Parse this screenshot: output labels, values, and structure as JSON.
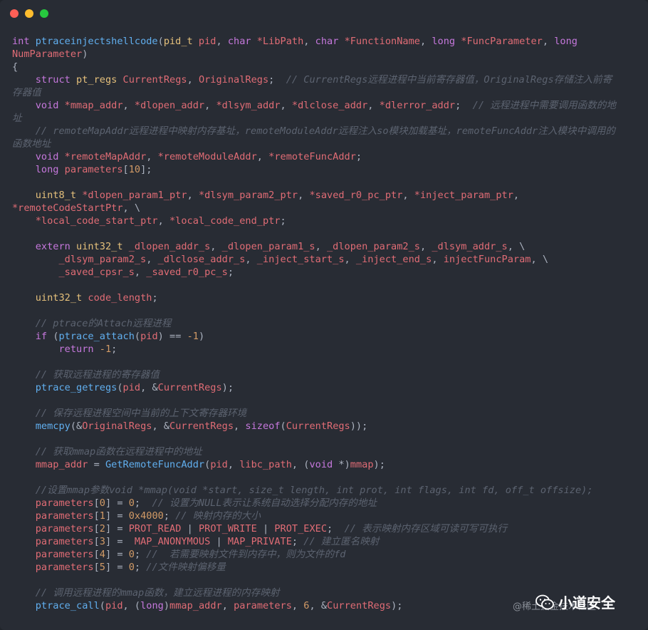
{
  "window": {
    "controls": [
      "close",
      "minimize",
      "maximize"
    ]
  },
  "code": {
    "language": "c",
    "lines": [
      [
        [
          "k",
          "int "
        ],
        [
          "f",
          "ptraceinjectshellcode"
        ],
        [
          "p",
          "("
        ],
        [
          "t",
          "pid_t "
        ],
        [
          "v",
          "pid"
        ],
        [
          "p",
          ", "
        ],
        [
          "k",
          "char "
        ],
        [
          "v",
          "*LibPath"
        ],
        [
          "p",
          ", "
        ],
        [
          "k",
          "char "
        ],
        [
          "v",
          "*FunctionName"
        ],
        [
          "p",
          ", "
        ],
        [
          "k",
          "long "
        ],
        [
          "v",
          "*FuncParameter"
        ],
        [
          "p",
          ", "
        ],
        [
          "k",
          "long"
        ]
      ],
      [
        [
          "v",
          "NumParameter"
        ],
        [
          "p",
          ")"
        ]
      ],
      [
        [
          "p",
          "{"
        ]
      ],
      [
        [
          "p",
          "    "
        ],
        [
          "k",
          "struct "
        ],
        [
          "t",
          "pt_regs "
        ],
        [
          "v",
          "CurrentRegs"
        ],
        [
          "p",
          ", "
        ],
        [
          "v",
          "OriginalRegs"
        ],
        [
          "p",
          ";  "
        ],
        [
          "c",
          "// CurrentRegs远程进程中当前寄存器值，OriginalRegs存储注入前寄"
        ]
      ],
      [
        [
          "c",
          "存器值"
        ]
      ],
      [
        [
          "p",
          "    "
        ],
        [
          "k",
          "void "
        ],
        [
          "v",
          "*mmap_addr"
        ],
        [
          "p",
          ", "
        ],
        [
          "v",
          "*dlopen_addr"
        ],
        [
          "p",
          ", "
        ],
        [
          "v",
          "*dlsym_addr"
        ],
        [
          "p",
          ", "
        ],
        [
          "v",
          "*dlclose_addr"
        ],
        [
          "p",
          ", "
        ],
        [
          "v",
          "*dlerror_addr"
        ],
        [
          "p",
          ";  "
        ],
        [
          "c",
          "// 远程进程中需要调用函数的地"
        ]
      ],
      [
        [
          "c",
          "址"
        ]
      ],
      [
        [
          "p",
          "    "
        ],
        [
          "c",
          "// remoteMapAddr远程进程中映射内存基址，remoteModuleAddr远程注入so模块加载基址，remoteFuncAddr注入模块中调用的"
        ]
      ],
      [
        [
          "c",
          "函数地址"
        ]
      ],
      [
        [
          "p",
          "    "
        ],
        [
          "k",
          "void "
        ],
        [
          "v",
          "*remoteMapAddr"
        ],
        [
          "p",
          ", "
        ],
        [
          "v",
          "*remoteModuleAddr"
        ],
        [
          "p",
          ", "
        ],
        [
          "v",
          "*remoteFuncAddr"
        ],
        [
          "p",
          ";"
        ]
      ],
      [
        [
          "p",
          "    "
        ],
        [
          "k",
          "long "
        ],
        [
          "v",
          "parameters"
        ],
        [
          "p",
          "["
        ],
        [
          "n",
          "10"
        ],
        [
          "p",
          "];"
        ]
      ],
      [],
      [
        [
          "p",
          "    "
        ],
        [
          "t",
          "uint8_t "
        ],
        [
          "v",
          "*dlopen_param1_ptr"
        ],
        [
          "p",
          ", "
        ],
        [
          "v",
          "*dlsym_param2_ptr"
        ],
        [
          "p",
          ", "
        ],
        [
          "v",
          "*saved_r0_pc_ptr"
        ],
        [
          "p",
          ", "
        ],
        [
          "v",
          "*inject_param_ptr"
        ],
        [
          "p",
          ","
        ]
      ],
      [
        [
          "v",
          "*remoteCodeStartPtr"
        ],
        [
          "p",
          ", \\"
        ]
      ],
      [
        [
          "p",
          "    "
        ],
        [
          "v",
          "*local_code_start_ptr"
        ],
        [
          "p",
          ", "
        ],
        [
          "v",
          "*local_code_end_ptr"
        ],
        [
          "p",
          ";"
        ]
      ],
      [],
      [
        [
          "p",
          "    "
        ],
        [
          "k",
          "extern "
        ],
        [
          "t",
          "uint32_t "
        ],
        [
          "v",
          "_dlopen_addr_s"
        ],
        [
          "p",
          ", "
        ],
        [
          "v",
          "_dlopen_param1_s"
        ],
        [
          "p",
          ", "
        ],
        [
          "v",
          "_dlopen_param2_s"
        ],
        [
          "p",
          ", "
        ],
        [
          "v",
          "_dlsym_addr_s"
        ],
        [
          "p",
          ", \\"
        ]
      ],
      [
        [
          "p",
          "        "
        ],
        [
          "v",
          "_dlsym_param2_s"
        ],
        [
          "p",
          ", "
        ],
        [
          "v",
          "_dlclose_addr_s"
        ],
        [
          "p",
          ", "
        ],
        [
          "v",
          "_inject_start_s"
        ],
        [
          "p",
          ", "
        ],
        [
          "v",
          "_inject_end_s"
        ],
        [
          "p",
          ", "
        ],
        [
          "v",
          "injectFuncParam"
        ],
        [
          "p",
          ", \\"
        ]
      ],
      [
        [
          "p",
          "        "
        ],
        [
          "v",
          "_saved_cpsr_s"
        ],
        [
          "p",
          ", "
        ],
        [
          "v",
          "_saved_r0_pc_s"
        ],
        [
          "p",
          ";"
        ]
      ],
      [],
      [
        [
          "p",
          "    "
        ],
        [
          "t",
          "uint32_t "
        ],
        [
          "v",
          "code_length"
        ],
        [
          "p",
          ";"
        ]
      ],
      [],
      [
        [
          "p",
          "    "
        ],
        [
          "c",
          "// ptrace的Attach远程进程"
        ]
      ],
      [
        [
          "p",
          "    "
        ],
        [
          "k",
          "if "
        ],
        [
          "p",
          "("
        ],
        [
          "f",
          "ptrace_attach"
        ],
        [
          "p",
          "("
        ],
        [
          "v",
          "pid"
        ],
        [
          "p",
          ") == "
        ],
        [
          "n",
          "-1"
        ],
        [
          "p",
          ")"
        ]
      ],
      [
        [
          "p",
          "        "
        ],
        [
          "k",
          "return "
        ],
        [
          "n",
          "-1"
        ],
        [
          "p",
          ";"
        ]
      ],
      [],
      [
        [
          "p",
          "    "
        ],
        [
          "c",
          "// 获取远程进程的寄存器值"
        ]
      ],
      [
        [
          "p",
          "    "
        ],
        [
          "f",
          "ptrace_getregs"
        ],
        [
          "p",
          "("
        ],
        [
          "v",
          "pid"
        ],
        [
          "p",
          ", &"
        ],
        [
          "v",
          "CurrentRegs"
        ],
        [
          "p",
          ");"
        ]
      ],
      [],
      [
        [
          "p",
          "    "
        ],
        [
          "c",
          "// 保存远程进程空间中当前的上下文寄存器环境"
        ]
      ],
      [
        [
          "p",
          "    "
        ],
        [
          "f",
          "memcpy"
        ],
        [
          "p",
          "(&"
        ],
        [
          "v",
          "OriginalRegs"
        ],
        [
          "p",
          ", &"
        ],
        [
          "v",
          "CurrentRegs"
        ],
        [
          "p",
          ", "
        ],
        [
          "k",
          "sizeof"
        ],
        [
          "p",
          "("
        ],
        [
          "v",
          "CurrentRegs"
        ],
        [
          "p",
          "));"
        ]
      ],
      [],
      [
        [
          "p",
          "    "
        ],
        [
          "c",
          "// 获取mmap函数在远程进程中的地址"
        ]
      ],
      [
        [
          "p",
          "    "
        ],
        [
          "v",
          "mmap_addr"
        ],
        [
          "p",
          " = "
        ],
        [
          "f",
          "GetRemoteFuncAddr"
        ],
        [
          "p",
          "("
        ],
        [
          "v",
          "pid"
        ],
        [
          "p",
          ", "
        ],
        [
          "v",
          "libc_path"
        ],
        [
          "p",
          ", ("
        ],
        [
          "k",
          "void "
        ],
        [
          "p",
          "*)"
        ],
        [
          "v",
          "mmap"
        ],
        [
          "p",
          ");"
        ]
      ],
      [],
      [
        [
          "p",
          "    "
        ],
        [
          "c",
          "//设置mmap参数void *mmap(void *start, size_t length, int prot, int flags, int fd, off_t offsize);"
        ]
      ],
      [
        [
          "p",
          "    "
        ],
        [
          "v",
          "parameters"
        ],
        [
          "p",
          "["
        ],
        [
          "n",
          "0"
        ],
        [
          "p",
          "] = "
        ],
        [
          "n",
          "0"
        ],
        [
          "p",
          ";  "
        ],
        [
          "c",
          "// 设置为NULL表示让系统自动选择分配内存的地址"
        ]
      ],
      [
        [
          "p",
          "    "
        ],
        [
          "v",
          "parameters"
        ],
        [
          "p",
          "["
        ],
        [
          "n",
          "1"
        ],
        [
          "p",
          "] = "
        ],
        [
          "n",
          "0x4000"
        ],
        [
          "p",
          "; "
        ],
        [
          "c",
          "// 映射内存的大小"
        ]
      ],
      [
        [
          "p",
          "    "
        ],
        [
          "v",
          "parameters"
        ],
        [
          "p",
          "["
        ],
        [
          "n",
          "2"
        ],
        [
          "p",
          "] = "
        ],
        [
          "v",
          "PROT_READ"
        ],
        [
          "p",
          " | "
        ],
        [
          "v",
          "PROT_WRITE"
        ],
        [
          "p",
          " | "
        ],
        [
          "v",
          "PROT_EXEC"
        ],
        [
          "p",
          ";  "
        ],
        [
          "c",
          "// 表示映射内存区域可读可写可执行"
        ]
      ],
      [
        [
          "p",
          "    "
        ],
        [
          "v",
          "parameters"
        ],
        [
          "p",
          "["
        ],
        [
          "n",
          "3"
        ],
        [
          "p",
          "] =  "
        ],
        [
          "v",
          "MAP_ANONYMOUS"
        ],
        [
          "p",
          " | "
        ],
        [
          "v",
          "MAP_PRIVATE"
        ],
        [
          "p",
          "; "
        ],
        [
          "c",
          "// 建立匿名映射"
        ]
      ],
      [
        [
          "p",
          "    "
        ],
        [
          "v",
          "parameters"
        ],
        [
          "p",
          "["
        ],
        [
          "n",
          "4"
        ],
        [
          "p",
          "] = "
        ],
        [
          "n",
          "0"
        ],
        [
          "p",
          "; "
        ],
        [
          "c",
          "//  若需要映射文件到内存中，则为文件的fd"
        ]
      ],
      [
        [
          "p",
          "    "
        ],
        [
          "v",
          "parameters"
        ],
        [
          "p",
          "["
        ],
        [
          "n",
          "5"
        ],
        [
          "p",
          "] = "
        ],
        [
          "n",
          "0"
        ],
        [
          "p",
          "; "
        ],
        [
          "c",
          "//文件映射偏移量"
        ]
      ],
      [],
      [
        [
          "p",
          "    "
        ],
        [
          "c",
          "// 调用远程进程的mmap函数，建立远程进程的内存映射"
        ]
      ],
      [
        [
          "p",
          "    "
        ],
        [
          "f",
          "ptrace_call"
        ],
        [
          "p",
          "("
        ],
        [
          "v",
          "pid"
        ],
        [
          "p",
          ", ("
        ],
        [
          "k",
          "long"
        ],
        [
          "p",
          ")"
        ],
        [
          "v",
          "mmap_addr"
        ],
        [
          "p",
          ", "
        ],
        [
          "v",
          "parameters"
        ],
        [
          "p",
          ", "
        ],
        [
          "n",
          "6"
        ],
        [
          "p",
          ", &"
        ],
        [
          "v",
          "CurrentRegs"
        ],
        [
          "p",
          ");"
        ]
      ]
    ]
  },
  "watermark": {
    "title": "小道安全",
    "sub": "@稀土掘金技术社区"
  },
  "colors": {
    "background": "#282c34",
    "keyword": "#c678dd",
    "type": "#e5c07b",
    "function": "#61afef",
    "variable": "#e06c75",
    "number": "#d19a66",
    "comment": "#5c6370"
  }
}
